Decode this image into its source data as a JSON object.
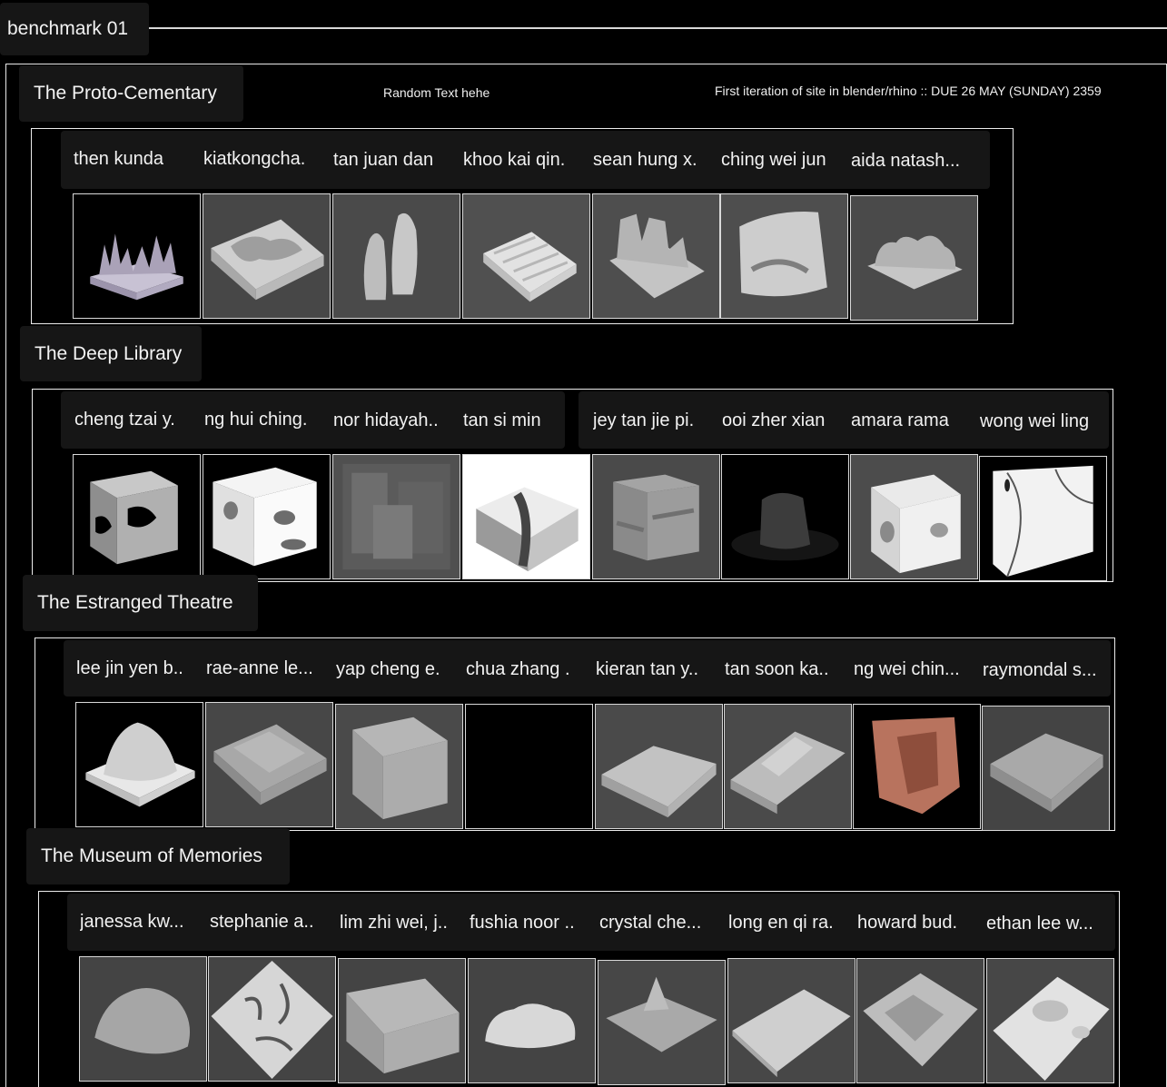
{
  "header": {
    "tab_title": "benchmark 01"
  },
  "sections": [
    {
      "title": "The Proto-Cementary",
      "note_center": "Random Text hehe",
      "note_right": "First iteration of site in blender/rhino :: DUE 26 MAY (SUNDAY) 2359",
      "entries": [
        {
          "name": "then kunda"
        },
        {
          "name": "kiatkongcha."
        },
        {
          "name": "tan juan dan"
        },
        {
          "name": "khoo kai qin."
        },
        {
          "name": "sean hung x."
        },
        {
          "name": "ching wei jun"
        },
        {
          "name": "aida natash..."
        }
      ]
    },
    {
      "title": "The Deep Library",
      "entries": [
        {
          "name": "cheng tzai y."
        },
        {
          "name": "ng hui ching."
        },
        {
          "name": "nor hidayah.."
        },
        {
          "name": "tan si min"
        },
        {
          "name": "jey tan jie pi."
        },
        {
          "name": "ooi zher xian"
        },
        {
          "name": "amara rama"
        },
        {
          "name": "wong wei ling"
        }
      ]
    },
    {
      "title": "The Estranged Theatre",
      "entries": [
        {
          "name": "lee jin yen b.."
        },
        {
          "name": "rae-anne le..."
        },
        {
          "name": "yap cheng e."
        },
        {
          "name": "chua zhang ."
        },
        {
          "name": "kieran tan y.."
        },
        {
          "name": "tan soon ka.."
        },
        {
          "name": "ng wei chin..."
        },
        {
          "name": "raymondal s..."
        }
      ]
    },
    {
      "title": "The Museum of Memories",
      "entries": [
        {
          "name": "janessa kw..."
        },
        {
          "name": "stephanie a.."
        },
        {
          "name": "lim zhi wei, j.."
        },
        {
          "name": "fushia noor .."
        },
        {
          "name": "crystal che..."
        },
        {
          "name": "long en qi ra."
        },
        {
          "name": "howard bud."
        },
        {
          "name": "ethan lee w..."
        }
      ]
    }
  ]
}
